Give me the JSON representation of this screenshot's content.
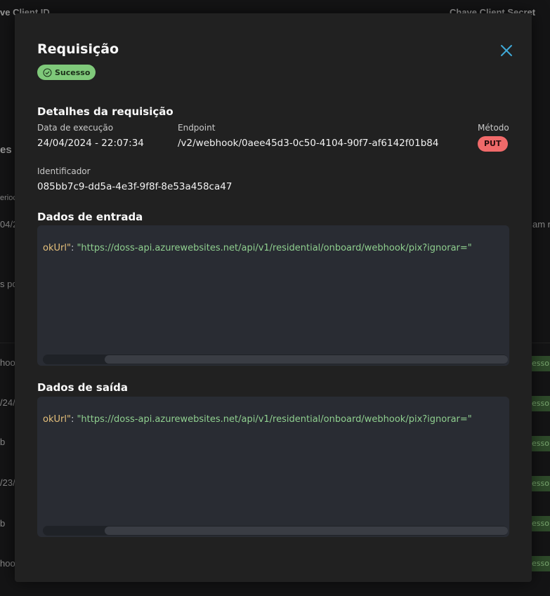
{
  "background": {
    "header_left": "ve Client ID",
    "header_right": "Chave Client Secret",
    "fragments": [
      "es",
      "erioc",
      "04/2",
      "s po",
      "hook",
      "/24/",
      "b",
      "/23/",
      "b",
      "hook"
    ],
    "right_fragment": "am n",
    "status_fragment": "esso"
  },
  "modal": {
    "title": "Requisição",
    "status": "Sucesso",
    "details_title": "Detalhes da requisição",
    "execution_label": "Data de execução",
    "execution_value": "24/04/2024 - 22:07:34",
    "endpoint_label": "Endpoint",
    "endpoint_value": "/v2/webhook/0aee45d3-0c50-4104-90f7-af6142f01b84",
    "method_label": "Método",
    "method_value": "PUT",
    "identifier_label": "Identificador",
    "identifier_value": "085bb7c9-dd5a-4e3f-9f8f-8e53a458ca47",
    "input_title": "Dados de entrada",
    "input_key": "okUrl\"",
    "input_sep": ": ",
    "input_value": "\"https://doss-api.azurewebsites.net/api/v1/residential/onboard/webhook/pix?ignorar=\"",
    "output_title": "Dados de saída",
    "output_key": "okUrl\"",
    "output_sep": ": ",
    "output_value": "\"https://doss-api.azurewebsites.net/api/v1/residential/onboard/webhook/pix?ignorar=\""
  },
  "colors": {
    "success": "#7fc97a",
    "method_put": "#f06a6a",
    "accent": "#3fa9d8"
  }
}
